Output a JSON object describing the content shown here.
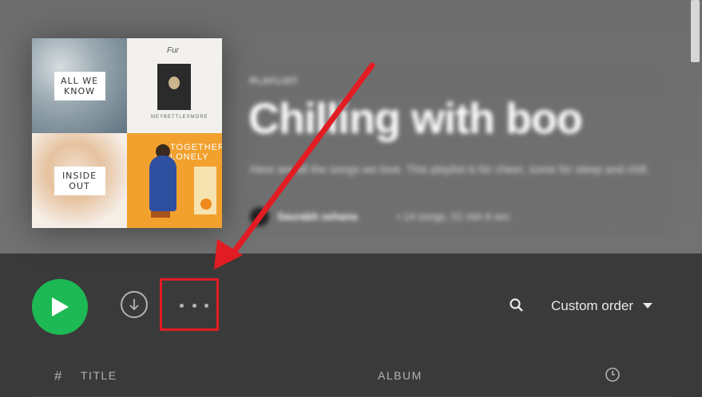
{
  "cover": {
    "tiles": [
      {
        "caption": "ALL WE KNOW"
      },
      {
        "script": "Fur",
        "small": "MEYBETTLESMORE"
      },
      {
        "caption": "INSIDE OUT"
      },
      {
        "title": "TOGETHER LONELY"
      }
    ]
  },
  "playlist": {
    "type": "PLAYLIST",
    "title": "Chilling with boo",
    "description": "Here are all the songs we love. This playlist is for cheer, some for sleep and chill.",
    "owner": "Saurabh sehana",
    "meta": "• 14 songs, 51 min 6 sec"
  },
  "actions": {
    "sort_label": "Custom order"
  },
  "track_header": {
    "num": "#",
    "title": "TITLE",
    "album": "ALBUM"
  },
  "icons": {
    "play": "play-icon",
    "download": "download-icon",
    "more": "more-icon",
    "search": "search-icon",
    "sort": "chevron-down-icon",
    "duration": "clock-icon"
  },
  "colors": {
    "accent": "#1db954",
    "highlight": "#e21c23"
  }
}
